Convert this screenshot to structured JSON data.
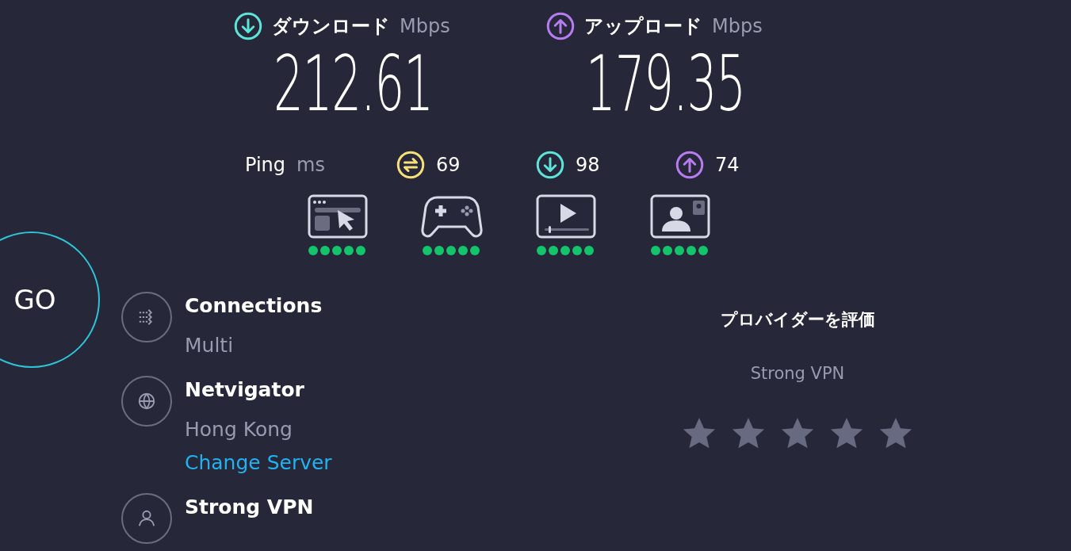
{
  "results": [
    {
      "kind": "download",
      "label": "ダウンロード",
      "unit": "Mbps",
      "value": "212.61"
    },
    {
      "kind": "upload",
      "label": "アップロード",
      "unit": "Mbps",
      "value": "179.35"
    }
  ],
  "ping": {
    "label": "Ping",
    "unit": "ms",
    "readings": [
      {
        "kind": "jitter",
        "value": "69"
      },
      {
        "kind": "download",
        "value": "98"
      },
      {
        "kind": "upload",
        "value": "74"
      }
    ]
  },
  "activities": [
    {
      "kind": "browsing",
      "stars": 5
    },
    {
      "kind": "gaming",
      "stars": 5
    },
    {
      "kind": "streaming",
      "stars": 5
    },
    {
      "kind": "video_call",
      "stars": 5
    }
  ],
  "go_button": "GO",
  "server_info": [
    {
      "kind": "connections",
      "title": "Connections",
      "subtitle": "Multi"
    },
    {
      "kind": "server",
      "title": "Netvigator",
      "subtitle": "Hong Kong",
      "link": "Change Server"
    },
    {
      "kind": "provider",
      "title": "Strong VPN"
    }
  ],
  "rating": {
    "title": "プロバイダーを評価",
    "provider": "Strong VPN"
  }
}
